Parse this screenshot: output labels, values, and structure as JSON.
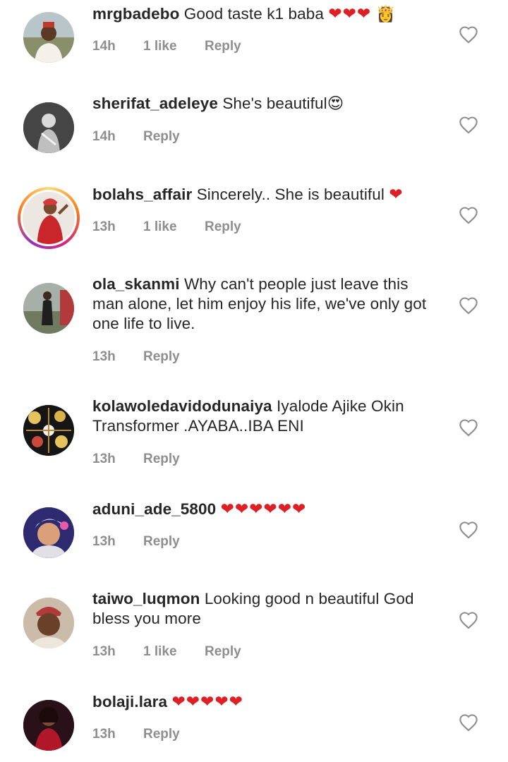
{
  "comments": [
    {
      "username": "mrgbadebo",
      "text": "Good taste k1 baba",
      "hearts": "❤❤❤",
      "extra_emoji": "👸",
      "time": "14h",
      "likes": "1 like",
      "reply": "Reply"
    },
    {
      "username": "sherifat_adeleye",
      "text": "She's beautiful",
      "hearts": "",
      "extra_emoji": "😍",
      "time": "14h",
      "likes": "",
      "reply": "Reply"
    },
    {
      "username": "bolahs_affair",
      "text": "Sincerely.. She is beautiful",
      "hearts": "❤",
      "extra_emoji": "",
      "time": "13h",
      "likes": "1 like",
      "reply": "Reply",
      "has_story": true
    },
    {
      "username": "ola_skanmi",
      "text": "Why can't people just leave this man alone, let him enjoy his life, we've only got one life to live.",
      "hearts": "",
      "extra_emoji": "",
      "time": "13h",
      "likes": "",
      "reply": "Reply"
    },
    {
      "username": "kolawoledavidodunaiya",
      "text": "Iyalode Ajike Okin Transformer .AYABA..IBA ENI",
      "hearts": "",
      "extra_emoji": "",
      "time": "13h",
      "likes": "",
      "reply": "Reply"
    },
    {
      "username": "aduni_ade_5800",
      "text": "",
      "hearts": "❤❤❤❤❤❤",
      "extra_emoji": "",
      "time": "13h",
      "likes": "",
      "reply": "Reply"
    },
    {
      "username": "taiwo_luqmon",
      "text": "Looking good n beautiful God bless you more",
      "hearts": "",
      "extra_emoji": "",
      "time": "13h",
      "likes": "1 like",
      "reply": "Reply"
    },
    {
      "username": "bolaji.lara",
      "text": "",
      "hearts": "❤❤❤❤❤",
      "extra_emoji": "",
      "time": "13h",
      "likes": "",
      "reply": "Reply"
    }
  ],
  "colors": {
    "text": "#262626",
    "meta": "#8e8e8e",
    "heart": "#dd1f26",
    "like_icon": "#8e8e8e"
  },
  "icons": {
    "like": "heart-outline-icon"
  }
}
